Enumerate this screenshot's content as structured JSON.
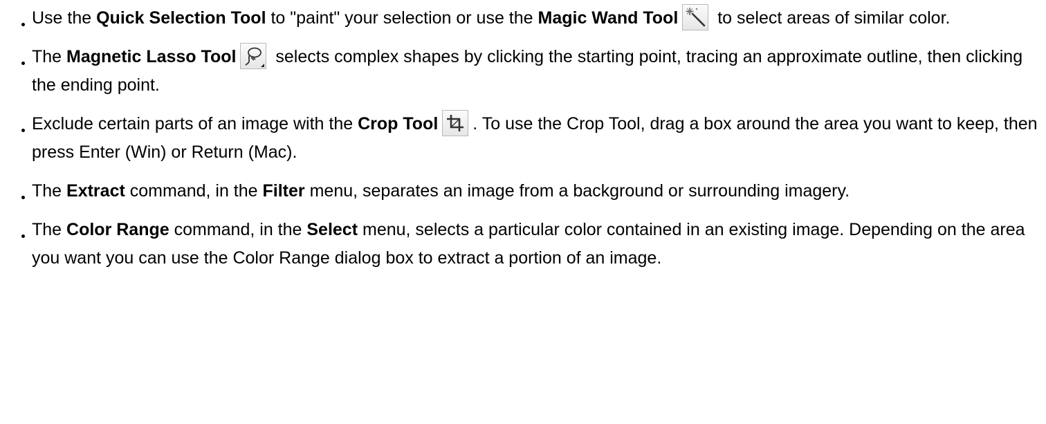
{
  "items": [
    {
      "t1": "Use the ",
      "b1": "Quick Selection Tool",
      "t2": " to \"paint\" your selection or use the ",
      "b2": "Magic Wand Tool",
      "t3": " to select areas of similar color.",
      "icon": "magic-wand-icon"
    },
    {
      "t1": "The ",
      "b1": "Magnetic Lasso Tool",
      "t2": " selects complex shapes by clicking the starting point, tracing an approximate outline, then clicking the ending point.",
      "icon": "magnetic-lasso-icon"
    },
    {
      "t1": "Exclude certain parts of an image with the ",
      "b1": "Crop Tool",
      "t2": ". To use the Crop Tool, drag a box around the area you want to keep, then press Enter (Win) or Return (Mac).",
      "icon": "crop-icon"
    },
    {
      "t1": "The ",
      "b1": "Extract",
      "t2": " command, in the ",
      "b2": "Filter",
      "t3": " menu, separates an image from a background or surrounding imagery."
    },
    {
      "t1": "The ",
      "b1": "Color Range",
      "t2": " command, in the ",
      "b2": "Select",
      "t3": " menu, selects a particular color contained in an existing image. Depending on the area you want you can use the Color Range dialog box to extract a portion of an image."
    }
  ]
}
